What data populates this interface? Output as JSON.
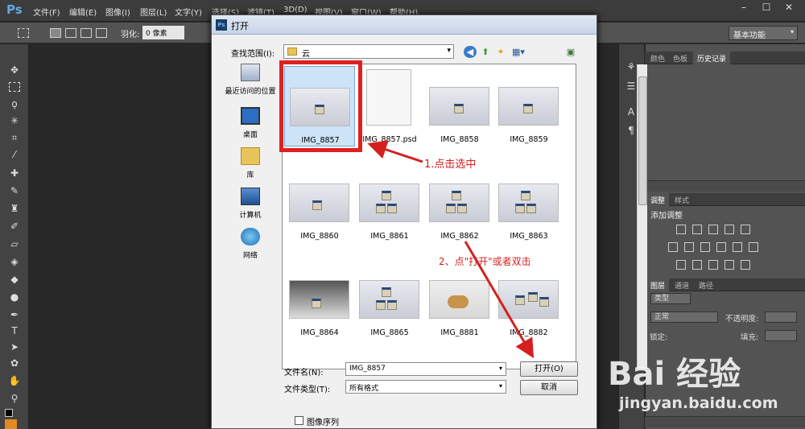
{
  "app": {
    "logo": "Ps"
  },
  "menu": [
    "文件(F)",
    "编辑(E)",
    "图像(I)",
    "图层(L)",
    "文字(Y)",
    "选择(S)",
    "滤镜(T)",
    "3D(D)",
    "视图(V)",
    "窗口(W)",
    "帮助(H)"
  ],
  "window_controls": [
    "–",
    "☐",
    "✕"
  ],
  "options_bar": {
    "feather_label": "羽化:",
    "feather_value": "0 像素",
    "workspace": "基本功能"
  },
  "right_panel": {
    "tabs_top": [
      "颜色",
      "色板",
      "历史记录"
    ],
    "tabs_adjust": [
      "调整",
      "样式"
    ],
    "adjust_title": "添加调整",
    "tabs_layers": [
      "图层",
      "通道",
      "路径"
    ],
    "layer_kind": "类型",
    "blend_mode": "正常",
    "opacity_label": "不透明度:",
    "lock_label": "锁定:",
    "fill_label": "填充:"
  },
  "dialog": {
    "title": "打开",
    "title_icon": "Ps",
    "lookin_label": "查找范围(I):",
    "lookin_value": "云",
    "places": [
      {
        "label": "最近访问的位置",
        "icon": "recent-places-icon"
      },
      {
        "label": "桌面",
        "icon": "desktop-icon"
      },
      {
        "label": "库",
        "icon": "libraries-icon"
      },
      {
        "label": "计算机",
        "icon": "computer-icon"
      },
      {
        "label": "网络",
        "icon": "network-icon"
      }
    ],
    "files": [
      "IMG_8857",
      "IMG_8857.psd",
      "IMG_8858",
      "IMG_8859",
      "IMG_8860",
      "IMG_8861",
      "IMG_8862",
      "IMG_8863",
      "IMG_8864",
      "IMG_8865",
      "IMG_8881",
      "IMG_8882"
    ],
    "filename_label": "文件名(N):",
    "filename_value": "IMG_8857",
    "filetype_label": "文件类型(T):",
    "filetype_value": "所有格式",
    "open_button": "打开(O)",
    "cancel_button": "取消",
    "sequence_label": "图像序列"
  },
  "annotations": {
    "step1": "1.点击选中",
    "step2": "2、点\"打开\"或者双击"
  },
  "watermark": {
    "text": "Bai 经验",
    "url": "jingyan.baidu.com"
  },
  "colors": {
    "highlight": "#e02020",
    "annotation": "#d42020"
  }
}
